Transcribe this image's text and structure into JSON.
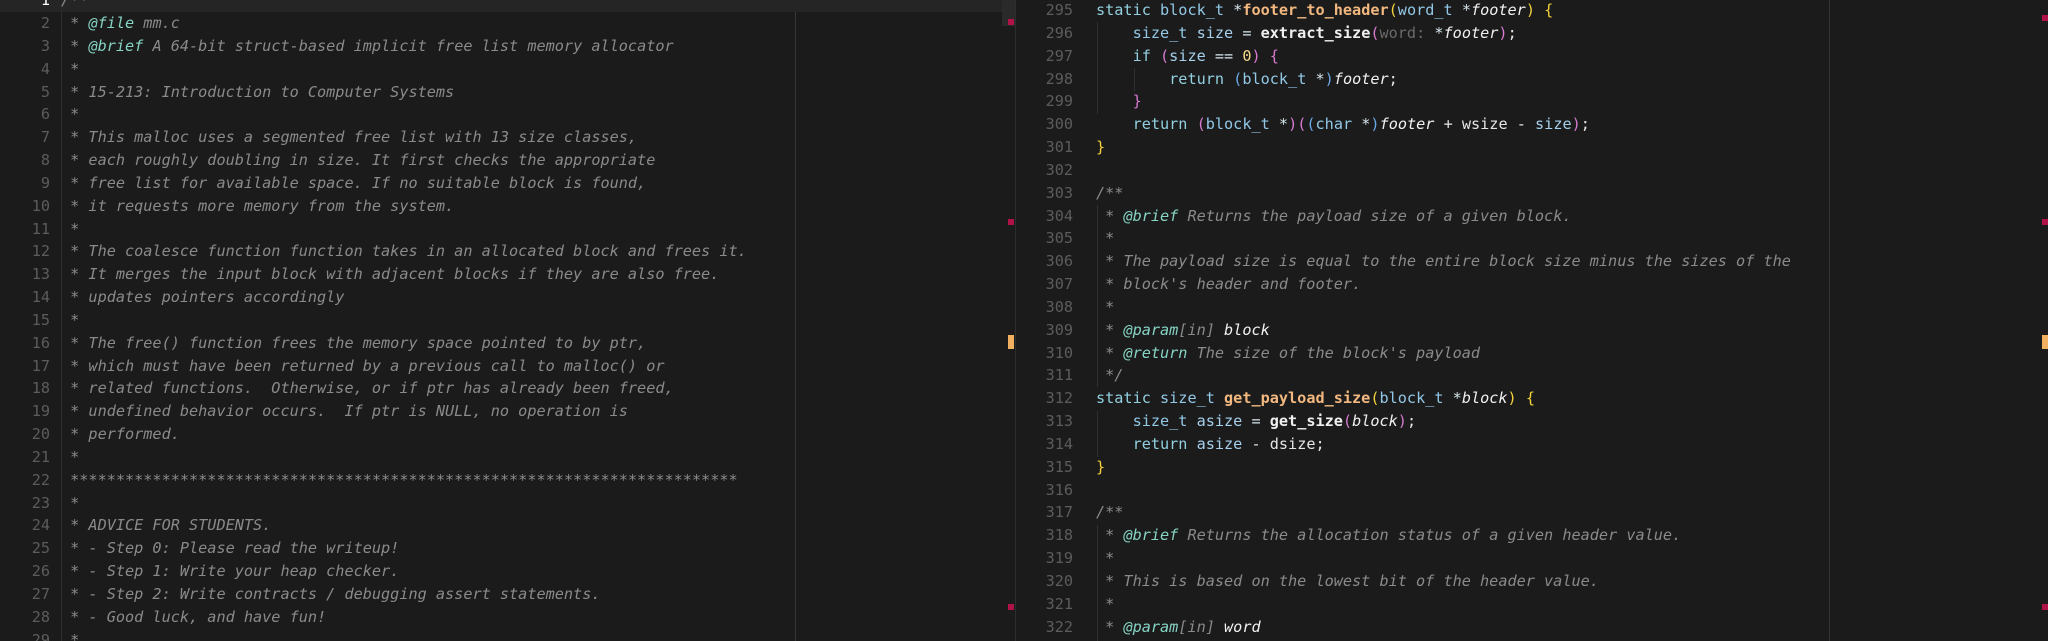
{
  "colors": {
    "background": "#1b1b1b",
    "error_marker": "#b0124a",
    "warning_marker": "#f0b060",
    "line_number": "#5c5c5c"
  },
  "left": {
    "current_line": 1,
    "lines": [
      {
        "n": "1",
        "tokens": [
          {
            "t": "/**",
            "c": "cm"
          }
        ]
      },
      {
        "n": "2",
        "tokens": [
          {
            "t": " * ",
            "c": "cm"
          },
          {
            "t": "@file",
            "c": "tag"
          },
          {
            "t": " mm.c",
            "c": "cm"
          }
        ]
      },
      {
        "n": "3",
        "tokens": [
          {
            "t": " * ",
            "c": "cm"
          },
          {
            "t": "@brief",
            "c": "tag"
          },
          {
            "t": " A 64-bit struct-based implicit free list memory allocator",
            "c": "cm"
          }
        ]
      },
      {
        "n": "4",
        "tokens": [
          {
            "t": " *",
            "c": "cm"
          }
        ]
      },
      {
        "n": "5",
        "tokens": [
          {
            "t": " * 15-213: Introduction to Computer Systems",
            "c": "cm"
          }
        ]
      },
      {
        "n": "6",
        "tokens": [
          {
            "t": " *",
            "c": "cm"
          }
        ]
      },
      {
        "n": "7",
        "tokens": [
          {
            "t": " * This malloc uses a segmented free list with 13 size classes,",
            "c": "cm"
          }
        ]
      },
      {
        "n": "8",
        "tokens": [
          {
            "t": " * each roughly doubling in size. It first checks the appropriate",
            "c": "cm"
          }
        ]
      },
      {
        "n": "9",
        "tokens": [
          {
            "t": " * free list for available space. If no suitable block is found,",
            "c": "cm"
          }
        ]
      },
      {
        "n": "10",
        "tokens": [
          {
            "t": " * it requests more memory from the system.",
            "c": "cm"
          }
        ]
      },
      {
        "n": "11",
        "tokens": [
          {
            "t": " *",
            "c": "cm"
          }
        ]
      },
      {
        "n": "12",
        "tokens": [
          {
            "t": " * The coalesce function function takes in an allocated block and frees it.",
            "c": "cm"
          }
        ]
      },
      {
        "n": "13",
        "tokens": [
          {
            "t": " * It merges the input block with adjacent blocks if they are also free.",
            "c": "cm"
          }
        ]
      },
      {
        "n": "14",
        "tokens": [
          {
            "t": " * updates pointers accordingly",
            "c": "cm"
          }
        ]
      },
      {
        "n": "15",
        "tokens": [
          {
            "t": " *",
            "c": "cm"
          }
        ]
      },
      {
        "n": "16",
        "tokens": [
          {
            "t": " * The free() function frees the memory space pointed to by ptr,",
            "c": "cm"
          }
        ]
      },
      {
        "n": "17",
        "tokens": [
          {
            "t": " * which must have been returned by a previous call to malloc() or",
            "c": "cm"
          }
        ]
      },
      {
        "n": "18",
        "tokens": [
          {
            "t": " * related functions.  Otherwise, or if ptr has already been freed,",
            "c": "cm"
          }
        ]
      },
      {
        "n": "19",
        "tokens": [
          {
            "t": " * undefined behavior occurs.  If ptr is NULL, no operation is",
            "c": "cm"
          }
        ]
      },
      {
        "n": "20",
        "tokens": [
          {
            "t": " * performed.",
            "c": "cm"
          }
        ]
      },
      {
        "n": "21",
        "tokens": [
          {
            "t": " *",
            "c": "cm"
          }
        ]
      },
      {
        "n": "22",
        "tokens": [
          {
            "t": " *************************************************************************",
            "c": "cm"
          }
        ]
      },
      {
        "n": "23",
        "tokens": [
          {
            "t": " *",
            "c": "cm"
          }
        ]
      },
      {
        "n": "24",
        "tokens": [
          {
            "t": " * ADVICE FOR STUDENTS.",
            "c": "cm"
          }
        ]
      },
      {
        "n": "25",
        "tokens": [
          {
            "t": " * - Step 0: Please read the writeup!",
            "c": "cm"
          }
        ]
      },
      {
        "n": "26",
        "tokens": [
          {
            "t": " * - Step 1: Write your heap checker.",
            "c": "cm"
          }
        ]
      },
      {
        "n": "27",
        "tokens": [
          {
            "t": " * - Step 2: Write contracts / debugging assert statements.",
            "c": "cm"
          }
        ]
      },
      {
        "n": "28",
        "tokens": [
          {
            "t": " * - Good luck, and have fun!",
            "c": "cm"
          }
        ]
      },
      {
        "n": "29",
        "tokens": [
          {
            "t": " *",
            "c": "cm"
          }
        ]
      }
    ]
  },
  "right": {
    "lines": [
      {
        "n": "295",
        "tokens": [
          {
            "t": "static ",
            "c": "kw"
          },
          {
            "t": "block_t ",
            "c": "ty"
          },
          {
            "t": "*",
            "c": "op"
          },
          {
            "t": "footer_to_header",
            "c": "fn"
          },
          {
            "t": "(",
            "c": "p1"
          },
          {
            "t": "word_t ",
            "c": "ty"
          },
          {
            "t": "*",
            "c": "op"
          },
          {
            "t": "footer",
            "c": "pa"
          },
          {
            "t": ")",
            "c": "p1"
          },
          {
            "t": " ",
            "c": "pl"
          },
          {
            "t": "{",
            "c": "p1"
          }
        ]
      },
      {
        "n": "296",
        "tokens": [
          {
            "t": "    ",
            "c": "pl"
          },
          {
            "t": "size_t ",
            "c": "ty"
          },
          {
            "t": "size ",
            "c": "va"
          },
          {
            "t": "= ",
            "c": "op"
          },
          {
            "t": "extract_size",
            "c": "fc"
          },
          {
            "t": "(",
            "c": "p2"
          },
          {
            "t": "word: ",
            "c": "hint"
          },
          {
            "t": "*",
            "c": "op"
          },
          {
            "t": "footer",
            "c": "pa"
          },
          {
            "t": ")",
            "c": "p2"
          },
          {
            "t": ";",
            "c": "pl"
          }
        ]
      },
      {
        "n": "297",
        "tokens": [
          {
            "t": "    ",
            "c": "pl"
          },
          {
            "t": "if ",
            "c": "kw"
          },
          {
            "t": "(",
            "c": "p2"
          },
          {
            "t": "size ",
            "c": "va"
          },
          {
            "t": "== ",
            "c": "op"
          },
          {
            "t": "0",
            "c": "nu"
          },
          {
            "t": ")",
            "c": "p2"
          },
          {
            "t": " ",
            "c": "pl"
          },
          {
            "t": "{",
            "c": "p2"
          }
        ]
      },
      {
        "n": "298",
        "tokens": [
          {
            "t": "        ",
            "c": "pl"
          },
          {
            "t": "return ",
            "c": "kw"
          },
          {
            "t": "(",
            "c": "p3"
          },
          {
            "t": "block_t ",
            "c": "ty"
          },
          {
            "t": "*",
            "c": "op"
          },
          {
            "t": ")",
            "c": "p3"
          },
          {
            "t": "footer",
            "c": "pa"
          },
          {
            "t": ";",
            "c": "pl"
          }
        ]
      },
      {
        "n": "299",
        "tokens": [
          {
            "t": "    ",
            "c": "pl"
          },
          {
            "t": "}",
            "c": "p2"
          }
        ]
      },
      {
        "n": "300",
        "tokens": [
          {
            "t": "    ",
            "c": "pl"
          },
          {
            "t": "return ",
            "c": "kw"
          },
          {
            "t": "(",
            "c": "p2"
          },
          {
            "t": "block_t ",
            "c": "ty"
          },
          {
            "t": "*",
            "c": "op"
          },
          {
            "t": ")",
            "c": "p2"
          },
          {
            "t": "(",
            "c": "p2"
          },
          {
            "t": "(",
            "c": "p3"
          },
          {
            "t": "char ",
            "c": "ty"
          },
          {
            "t": "*",
            "c": "op"
          },
          {
            "t": ")",
            "c": "p3"
          },
          {
            "t": "footer",
            "c": "pa"
          },
          {
            "t": " + wsize - ",
            "c": "pl"
          },
          {
            "t": "size",
            "c": "va"
          },
          {
            "t": ")",
            "c": "p2"
          },
          {
            "t": ";",
            "c": "pl"
          }
        ]
      },
      {
        "n": "301",
        "tokens": [
          {
            "t": "}",
            "c": "p1"
          }
        ]
      },
      {
        "n": "302",
        "tokens": []
      },
      {
        "n": "303",
        "tokens": [
          {
            "t": "/**",
            "c": "cm"
          }
        ]
      },
      {
        "n": "304",
        "tokens": [
          {
            "t": " * ",
            "c": "cm"
          },
          {
            "t": "@brief",
            "c": "tag"
          },
          {
            "t": " Returns the payload size of a given block.",
            "c": "cm"
          }
        ]
      },
      {
        "n": "305",
        "tokens": [
          {
            "t": " *",
            "c": "cm"
          }
        ]
      },
      {
        "n": "306",
        "tokens": [
          {
            "t": " * The payload size is equal to the entire block size minus the sizes of the",
            "c": "cm"
          }
        ]
      },
      {
        "n": "307",
        "tokens": [
          {
            "t": " * block's header and footer.",
            "c": "cm"
          }
        ]
      },
      {
        "n": "308",
        "tokens": [
          {
            "t": " *",
            "c": "cm"
          }
        ]
      },
      {
        "n": "309",
        "tokens": [
          {
            "t": " * ",
            "c": "cm"
          },
          {
            "t": "@param",
            "c": "tag"
          },
          {
            "t": "[in] ",
            "c": "cm"
          },
          {
            "t": "block",
            "c": "pa"
          }
        ]
      },
      {
        "n": "310",
        "tokens": [
          {
            "t": " * ",
            "c": "cm"
          },
          {
            "t": "@return",
            "c": "tag"
          },
          {
            "t": " The size of the block's payload",
            "c": "cm"
          }
        ]
      },
      {
        "n": "311",
        "tokens": [
          {
            "t": " */",
            "c": "cm"
          }
        ]
      },
      {
        "n": "312",
        "tokens": [
          {
            "t": "static ",
            "c": "kw"
          },
          {
            "t": "size_t ",
            "c": "ty"
          },
          {
            "t": "get_payload_size",
            "c": "fn"
          },
          {
            "t": "(",
            "c": "p1"
          },
          {
            "t": "block_t ",
            "c": "ty"
          },
          {
            "t": "*",
            "c": "op"
          },
          {
            "t": "block",
            "c": "pa"
          },
          {
            "t": ")",
            "c": "p1"
          },
          {
            "t": " ",
            "c": "pl"
          },
          {
            "t": "{",
            "c": "p1"
          }
        ]
      },
      {
        "n": "313",
        "tokens": [
          {
            "t": "    ",
            "c": "pl"
          },
          {
            "t": "size_t ",
            "c": "ty"
          },
          {
            "t": "asize ",
            "c": "va"
          },
          {
            "t": "= ",
            "c": "op"
          },
          {
            "t": "get_size",
            "c": "fc"
          },
          {
            "t": "(",
            "c": "p2"
          },
          {
            "t": "block",
            "c": "pa"
          },
          {
            "t": ")",
            "c": "p2"
          },
          {
            "t": ";",
            "c": "pl"
          }
        ]
      },
      {
        "n": "314",
        "tokens": [
          {
            "t": "    ",
            "c": "pl"
          },
          {
            "t": "return ",
            "c": "kw"
          },
          {
            "t": "asize ",
            "c": "va"
          },
          {
            "t": "- ",
            "c": "op"
          },
          {
            "t": "dsize;",
            "c": "pl"
          }
        ]
      },
      {
        "n": "315",
        "tokens": [
          {
            "t": "}",
            "c": "p1"
          }
        ]
      },
      {
        "n": "316",
        "tokens": []
      },
      {
        "n": "317",
        "tokens": [
          {
            "t": "/**",
            "c": "cm"
          }
        ]
      },
      {
        "n": "318",
        "tokens": [
          {
            "t": " * ",
            "c": "cm"
          },
          {
            "t": "@brief",
            "c": "tag"
          },
          {
            "t": " Returns the allocation status of a given header value.",
            "c": "cm"
          }
        ]
      },
      {
        "n": "319",
        "tokens": [
          {
            "t": " *",
            "c": "cm"
          }
        ]
      },
      {
        "n": "320",
        "tokens": [
          {
            "t": " * This is based on the lowest bit of the header value.",
            "c": "cm"
          }
        ]
      },
      {
        "n": "321",
        "tokens": [
          {
            "t": " *",
            "c": "cm"
          }
        ]
      },
      {
        "n": "322",
        "tokens": [
          {
            "t": " * ",
            "c": "cm"
          },
          {
            "t": "@param",
            "c": "tag"
          },
          {
            "t": "[in] ",
            "c": "cm"
          },
          {
            "t": "word",
            "c": "pa"
          }
        ]
      }
    ]
  }
}
